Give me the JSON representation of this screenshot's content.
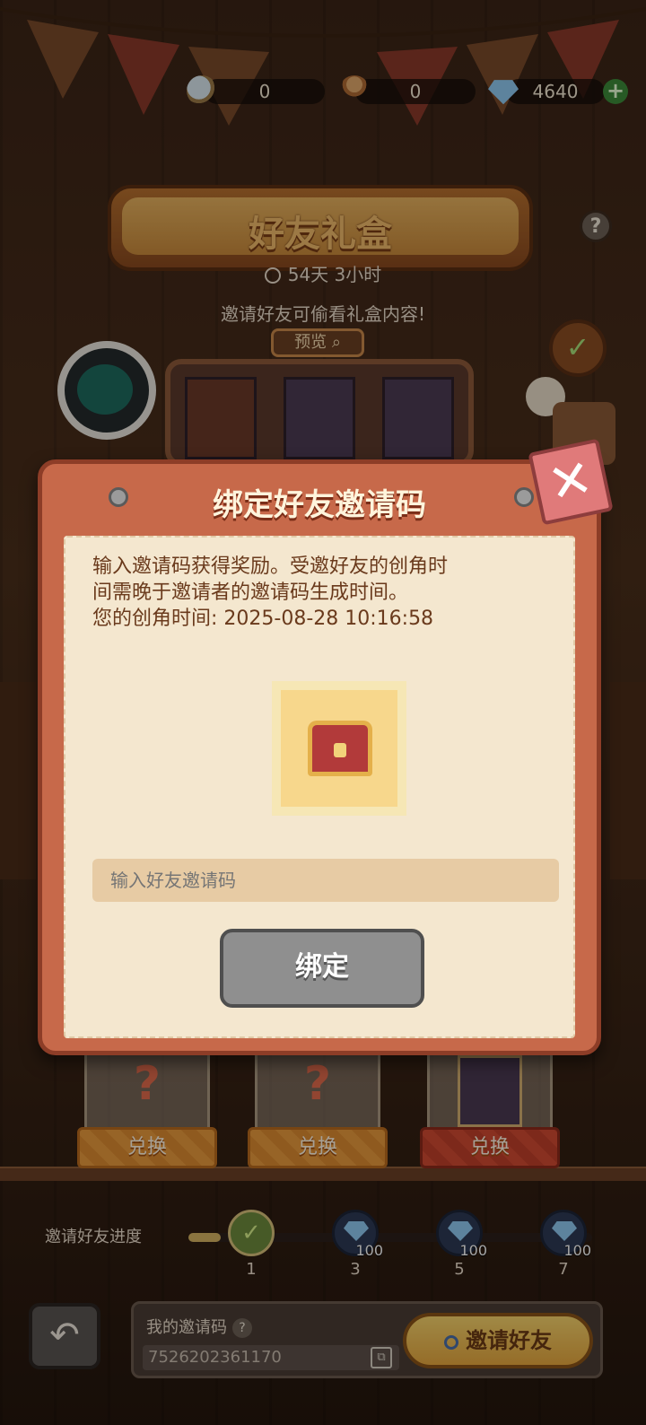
{
  "resources": {
    "magnifier_count": "0",
    "key_count": "0",
    "gem_count": "4640",
    "add_label": "+",
    "icons": [
      "magnifier-icon",
      "key-icon",
      "gem-icon",
      "plus-icon"
    ]
  },
  "header": {
    "title": "好友礼盒",
    "help_label": "?",
    "timer_text": "54天 3小时",
    "hint_text": "邀请好友可偷看礼盒内容!",
    "preview_label": "预览"
  },
  "exchange": {
    "slots": [
      {
        "label": "兑换",
        "locked_mark": "?"
      },
      {
        "label": "兑换",
        "locked_mark": "?"
      },
      {
        "label": "兑换",
        "locked_mark": ""
      }
    ]
  },
  "progress": {
    "label": "邀请好友进度",
    "fill_fraction": 0.08,
    "nodes": [
      {
        "tick": "1",
        "reward": "",
        "done": true
      },
      {
        "tick": "3",
        "reward": "100",
        "done": false
      },
      {
        "tick": "5",
        "reward": "100",
        "done": false
      },
      {
        "tick": "7",
        "reward": "100",
        "done": false
      }
    ]
  },
  "footer": {
    "back_label": "↶",
    "my_code_label": "我的邀请码",
    "my_code_help": "?",
    "my_code_value": "7526202361170",
    "invite_button": "邀请好友"
  },
  "modal": {
    "title": "绑定好友邀请码",
    "description_line1": "输入邀请码获得奖励。受邀好友的创角时",
    "description_line2": "间需晚于邀请者的邀请码生成时间。",
    "description_line3": "您的创角时间: 2025-08-28 10:16:58",
    "input_placeholder": "输入好友邀请码",
    "bind_button": "绑定",
    "close_label": "✕"
  },
  "colors": {
    "modal_frame": "#c7694a",
    "paper": "#f4e7cf",
    "text_brown": "#6a3a1c",
    "exchange_orange": "#e89a3c",
    "exchange_red": "#d24a32",
    "progress_fill": "#d5b262"
  }
}
